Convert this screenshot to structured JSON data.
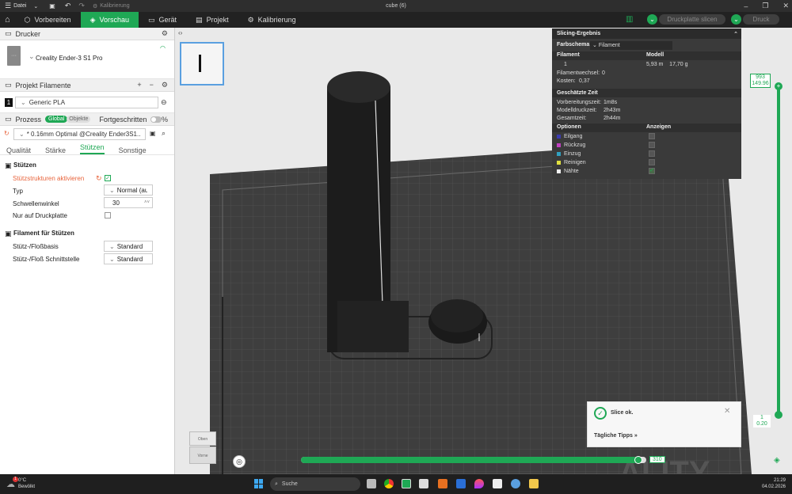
{
  "title": {
    "menu": "Datei",
    "calibration": "Kalibrierung",
    "window_title": "cube (6)"
  },
  "tabs": {
    "prepare": "Vorbereiten",
    "preview": "Vorschau",
    "device": "Gerät",
    "project": "Projekt",
    "calibration": "Kalibrierung"
  },
  "top_actions": {
    "slice_plate": "Druckplatte slicen",
    "print": "Druck"
  },
  "left": {
    "printer_header": "Drucker",
    "printer_name": "Creality Ender-3 S1 Pro",
    "filament_header": "Projekt Filamente",
    "filament_index": "1",
    "filament_name": "Generic PLA",
    "process_header": "Prozess",
    "process_global": "Global",
    "process_objects": "Objekte",
    "advanced": "Fortgeschritten",
    "profile": "* 0.16mm Optimal @Creality Ender3S1...",
    "subtabs": [
      "Qualität",
      "Stärke",
      "Stützen",
      "Sonstige"
    ],
    "support_section": "Stützen",
    "enable_support": "Stützstrukturen aktivieren",
    "type_label": "Typ",
    "type_value": "Normal (au...",
    "threshold_label": "Schwellenwinkel",
    "threshold_value": "30",
    "build_plate_only": "Nur auf Druckplatte",
    "filament_support_section": "Filament für Stützen",
    "raft_label": "Stütz-/Floßbasis",
    "raft_value": "Standard",
    "interface_label": "Stütz-/Floß Schnittstelle",
    "interface_value": "Standard"
  },
  "slicing": {
    "title": "Slicing-Ergebnis",
    "scheme_label": "Farbschema",
    "scheme_value": "Filament",
    "col_filament": "Filament",
    "col_model": "Modell",
    "filament_no": "1",
    "model_values": "5,93 m    17,70 g",
    "changes_label": "Filamentwechsel:",
    "changes_value": "0",
    "cost_label": "Kosten:",
    "cost_value": "0,37",
    "time_header": "Geschätzte Zeit",
    "prep_label": "Vorbereitungszeit:",
    "prep_value": "1m8s",
    "model_time_label": "Modelldruckzeit:",
    "model_time_value": "2h43m",
    "total_label": "Gesamtzeit:",
    "total_value": "2h44m",
    "options_header": "Optionen",
    "show_header": "Anzeigen",
    "options": [
      {
        "label": "Eilgang",
        "color": "#3b3bb0"
      },
      {
        "label": "Rückzug",
        "color": "#c040c0"
      },
      {
        "label": "Einzug",
        "color": "#30a0c0"
      },
      {
        "label": "Reinigen",
        "color": "#e0e040"
      },
      {
        "label": "Nähte",
        "color": "#f0f0f0"
      }
    ]
  },
  "layer_slider": {
    "top_a": "993",
    "top_b": "149.96",
    "bottom_a": "1",
    "bottom_b": "0.20"
  },
  "progress": {
    "value": "310",
    "fraction": 0.98
  },
  "toast": {
    "status": "Slice ok.",
    "tips": "Tägliche Tipps"
  },
  "view_cube": {
    "top": "Oben",
    "front": "Vorne"
  },
  "bed_text": "ALITY",
  "taskbar": {
    "temp": "0°C",
    "weather": "Bewölkt",
    "badge": "1",
    "search": "Suche",
    "time": "21:29",
    "date": "04.02.2026"
  },
  "colors": {
    "accent": "#1fa855"
  }
}
